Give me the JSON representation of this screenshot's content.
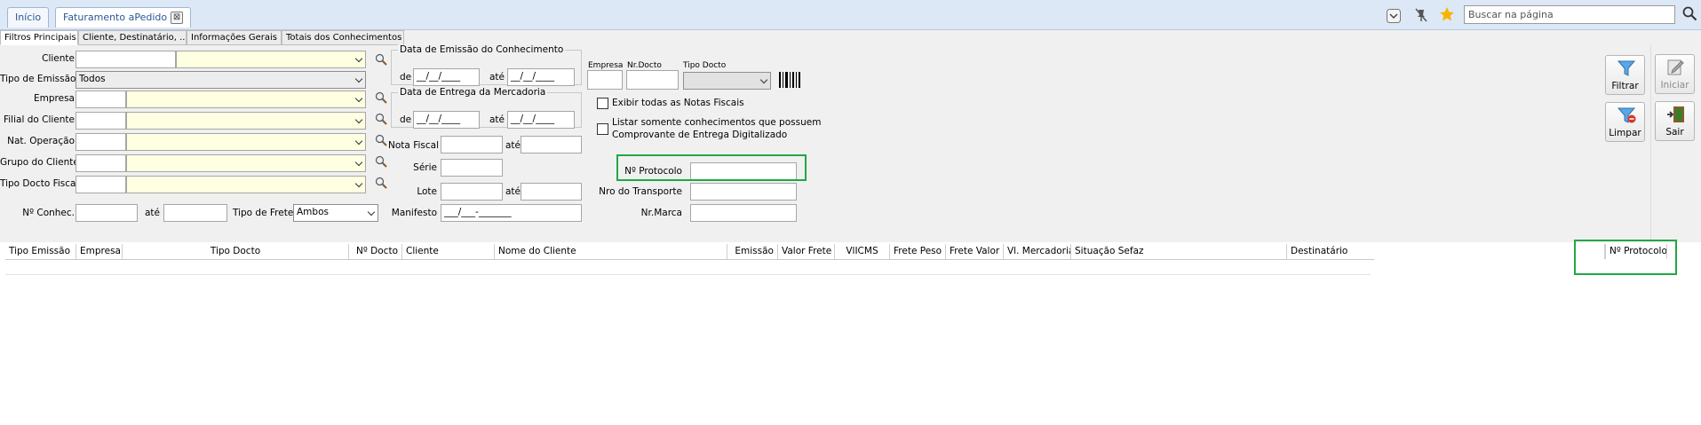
{
  "tabs": {
    "home": "Início",
    "current": "Faturamento aPedido",
    "close": "⊠"
  },
  "header": {
    "search_placeholder": "Buscar na página"
  },
  "subtabs": [
    "Filtros Principais",
    "Cliente, Destinatário, ...",
    "Informações Gerais",
    "Totais dos Conhecimentos"
  ],
  "filters": {
    "cliente": "Cliente",
    "tipo_emissao": "Tipo de Emissão",
    "tipo_emissao_value": "Todos",
    "empresa": "Empresa",
    "filial": "Filial do Cliente",
    "nat_operacao": "Nat. Operação",
    "grupo": "Grupo do Cliente",
    "tipo_docto_fiscal": "Tipo Docto Fiscal",
    "n_conhec": "Nº Conhec.",
    "ate": "até",
    "tipo_frete": "Tipo de Frete",
    "tipo_frete_value": "Ambos"
  },
  "dates": {
    "emissao_title": "Data de Emissão do Conhecimento",
    "entrega_title": "Data de Entrega da Mercadoria",
    "de": "de",
    "ate": "até",
    "mask": "__/__/____"
  },
  "middle": {
    "nota_fiscal": "Nota Fiscal",
    "serie": "Série",
    "lote": "Lote",
    "manifesto": "Manifesto",
    "manifesto_mask": "___/___-_______",
    "ate": "até"
  },
  "right": {
    "empresa": "Empresa",
    "nr_docto": "Nr.Docto",
    "tipo_docto": "Tipo Docto",
    "exibir": "Exibir todas as Notas Fiscais",
    "listar_1": "Listar somente conhecimentos que possuem",
    "listar_2": "Comprovante de Entrega Digitalizado",
    "protocolo": "Nº Protocolo",
    "transporte": "Nro do Transporte",
    "marca": "Nr.Marca"
  },
  "buttons": {
    "filtrar": "Filtrar",
    "limpar": "Limpar",
    "iniciar": "Iniciar",
    "sair": "Sair"
  },
  "grid": {
    "columns": [
      "Tipo Emissão",
      "Empresa",
      "Tipo Docto",
      "Nº Docto",
      "Cliente",
      "Nome do Cliente",
      "Emissão",
      "Valor Frete",
      "VlICMS",
      "Frete Peso",
      "Frete Valor",
      "Vl. Mercadoria",
      "Situação Sefaz",
      "Destinatário",
      "",
      "Nº Protocolo"
    ]
  }
}
